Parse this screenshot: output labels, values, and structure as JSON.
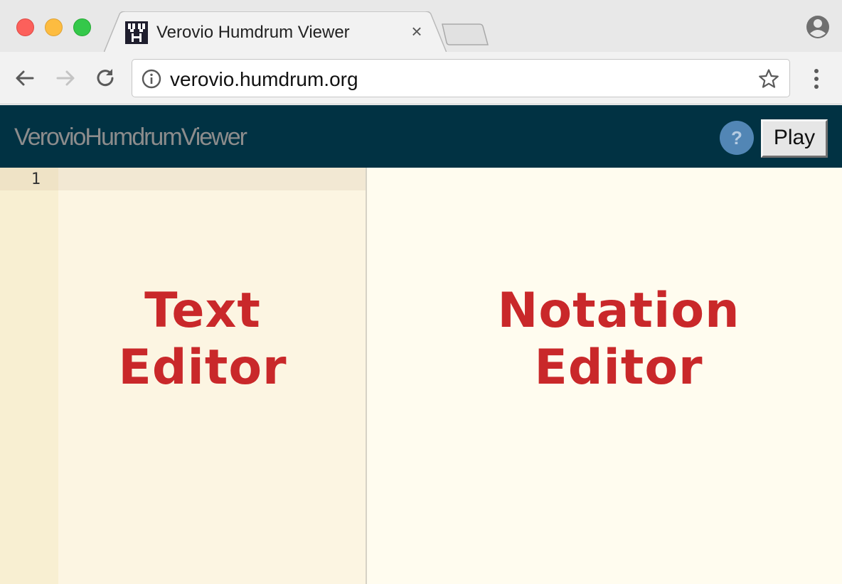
{
  "browser": {
    "tab": {
      "title": "Verovio Humdrum Viewer",
      "close_glyph": "×",
      "favicon": "vhv-favicon-icon"
    },
    "url": "verovio.humdrum.org",
    "icons": {
      "back": "arrow-left-icon",
      "forward": "arrow-right-icon",
      "reload": "reload-icon",
      "info": "info-icon",
      "bookmark": "star-icon",
      "menu": "kebab-menu-icon",
      "profile": "account-icon"
    },
    "colors": {
      "close": "#fc605b",
      "minimize": "#fdbc40",
      "maximize": "#34c84a"
    }
  },
  "app": {
    "title": "VerovioHumdrumViewer",
    "help_label": "?",
    "play_label": "Play",
    "colors": {
      "header_bg": "#013243",
      "help_bg": "#5286b5",
      "label": "#c9282a"
    }
  },
  "text_editor": {
    "line_numbers": [
      "1"
    ],
    "overlay_line1": "Text",
    "overlay_line2": "Editor"
  },
  "notation_editor": {
    "overlay_line1": "Notation",
    "overlay_line2": "Editor"
  }
}
